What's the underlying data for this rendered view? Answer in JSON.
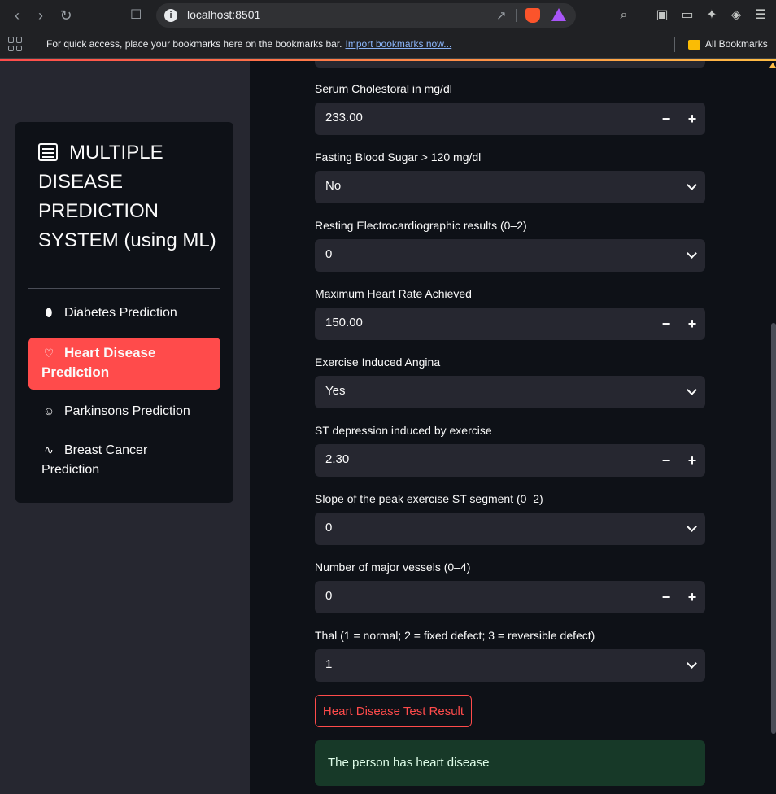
{
  "browser": {
    "url": "localhost:8501",
    "bookmarks_prompt": "For quick access, place your bookmarks here on the bookmarks bar.",
    "bookmarks_link": "Import bookmarks now...",
    "all_bookmarks": "All Bookmarks"
  },
  "sidebar": {
    "title": "MULTIPLE DISEASE PREDICTION SYSTEM (using ML)",
    "items": [
      {
        "label": "Diabetes Prediction",
        "icon": "capsule-icon"
      },
      {
        "label": "Heart Disease Prediction",
        "icon": "heart-icon",
        "active": true
      },
      {
        "label": "Parkinsons Prediction",
        "icon": "person-icon"
      },
      {
        "label": "Breast Cancer Prediction",
        "icon": "activity-icon"
      }
    ]
  },
  "form": {
    "fields": [
      {
        "label": "Serum Cholestoral in mg/dl",
        "value": "233.00",
        "type": "number"
      },
      {
        "label": "Fasting Blood Sugar > 120 mg/dl",
        "value": "No",
        "type": "select"
      },
      {
        "label": "Resting Electrocardiographic results (0–2)",
        "value": "0",
        "type": "select"
      },
      {
        "label": "Maximum Heart Rate Achieved",
        "value": "150.00",
        "type": "number"
      },
      {
        "label": "Exercise Induced Angina",
        "value": "Yes",
        "type": "select"
      },
      {
        "label": "ST depression induced by exercise",
        "value": "2.30",
        "type": "number"
      },
      {
        "label": "Slope of the peak exercise ST segment (0–2)",
        "value": "0",
        "type": "select"
      },
      {
        "label": "Number of major vessels (0–4)",
        "value": "0",
        "type": "number"
      },
      {
        "label": "Thal (1 = normal; 2 = fixed defect; 3 = reversible defect)",
        "value": "1",
        "type": "select"
      }
    ],
    "stepper_minus": "−",
    "stepper_plus": "+",
    "submit_label": "Heart Disease Test Result",
    "result_text": "The person has heart disease"
  },
  "colors": {
    "primary": "#ff4b4b",
    "background": "#0e1117",
    "sidebar": "#262730",
    "success_bg": "#173928"
  }
}
